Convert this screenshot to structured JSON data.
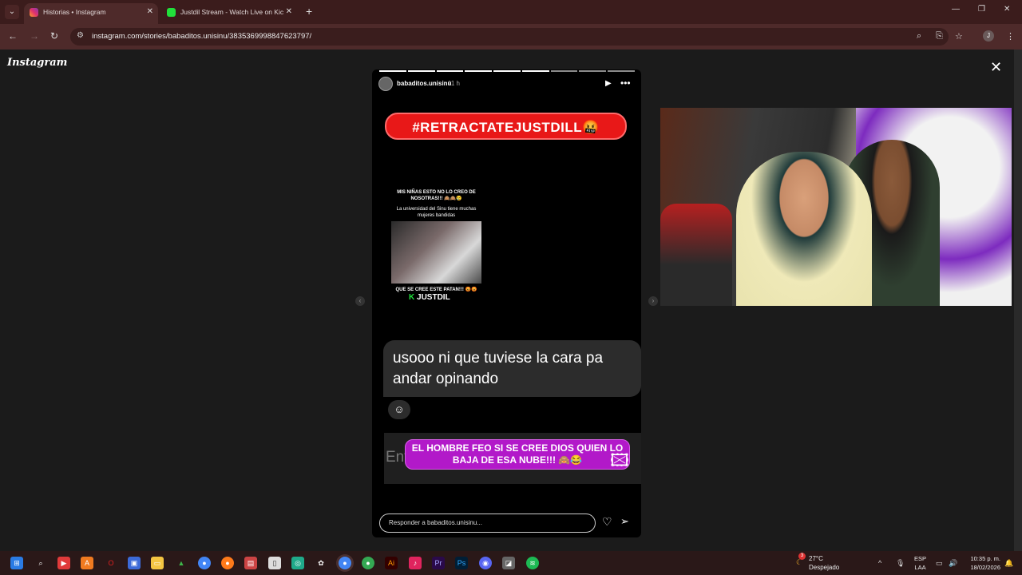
{
  "browser": {
    "tabs": [
      {
        "title": "Historias • Instagram",
        "active": true
      },
      {
        "title": "Justdil Stream - Watch Live on Kick",
        "active": false
      }
    ],
    "url": "instagram.com/stories/babaditos.unisinu/3835369998847623797/",
    "profile_initial": "J"
  },
  "page": {
    "logo": "Instagram",
    "story": {
      "username": "babaditos.unisinu",
      "time": "11 h",
      "hashtag": "#RETRACTATEJUSTDILL🤬",
      "mini_title": "MIS NIÑAS ESTO NO LO CREO DE NOSOTRAS!!! 🙈🙈😢",
      "mini_sub": "La universidad del Sinu tiene muchas mujeres bandidas",
      "mini_caption": "QUE SE CREE ESTE PATAN!!! 😡😡",
      "mini_brand": "JUSTDIL",
      "message": "usooo ni que tuviese la cara pa andar opinando",
      "send_text": "Envi",
      "banner": "EL HOMBRE FEO SI SE CREE DIOS QUIEN LO BAJA DE ESA NUBE!!! 🙈😂",
      "reply_placeholder": "Responder a babaditos.unisinu..."
    }
  },
  "taskbar": {
    "weather_temp": "27°C",
    "weather_desc": "Despejado",
    "lang_top": "ESP",
    "lang_bottom": "LAA",
    "time": "10:35 p. m.",
    "date": "18/02/2026",
    "weather_badge": "3"
  },
  "colors": {
    "accent_red": "#e81818",
    "banner_purple": "#b219c9",
    "kick_green": "#21e03b"
  }
}
